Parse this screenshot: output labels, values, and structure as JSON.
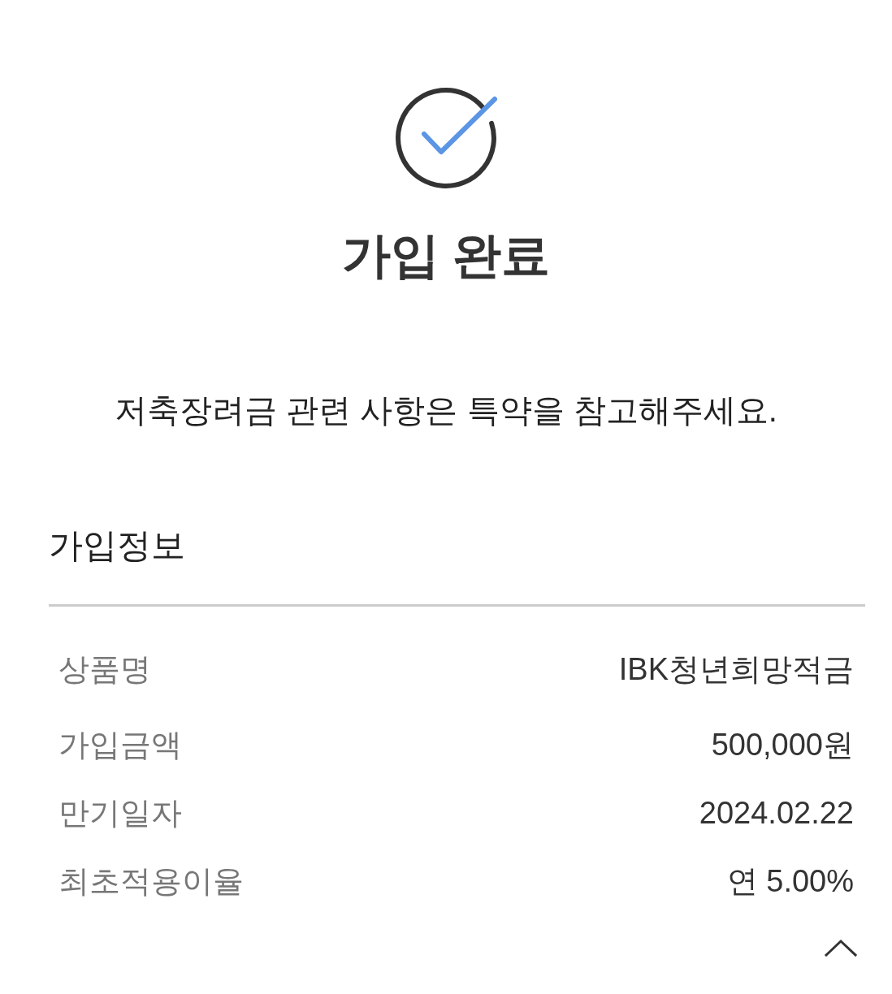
{
  "completion": {
    "title": "가입 완료",
    "message": "저축장려금 관련 사항은 특약을 참고해주세요."
  },
  "info": {
    "heading": "가입정보",
    "rows": [
      {
        "label": "상품명",
        "value": "IBK청년희망적금"
      },
      {
        "label": "가입금액",
        "value": "500,000원"
      },
      {
        "label": "만기일자",
        "value": "2024.02.22"
      },
      {
        "label": "최초적용이율",
        "value": "연 5.00%"
      }
    ]
  },
  "collapse": {
    "expanded": true
  }
}
